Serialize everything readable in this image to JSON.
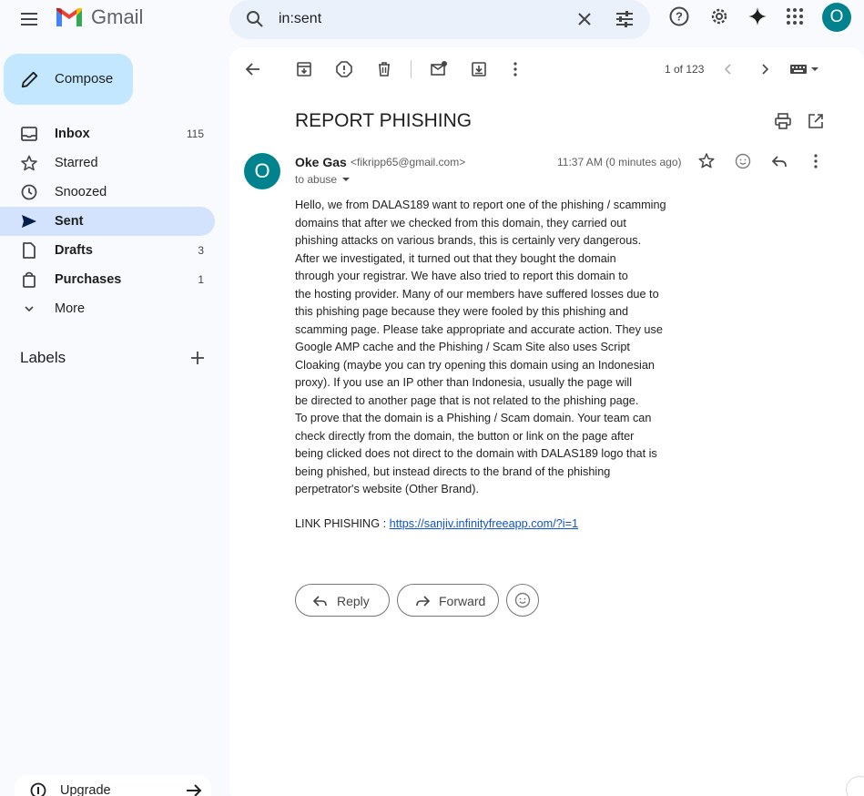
{
  "app": {
    "name": "Gmail"
  },
  "search": {
    "value": "in:sent"
  },
  "account": {
    "initial": "O"
  },
  "sidebar": {
    "compose_label": "Compose",
    "items": [
      {
        "label": "Inbox",
        "count": "115",
        "icon": "inbox-icon"
      },
      {
        "label": "Starred",
        "count": "",
        "icon": "star-icon"
      },
      {
        "label": "Snoozed",
        "count": "",
        "icon": "clock-icon"
      },
      {
        "label": "Sent",
        "count": "",
        "icon": "send-icon"
      },
      {
        "label": "Drafts",
        "count": "3",
        "icon": "draft-icon"
      },
      {
        "label": "Purchases",
        "count": "1",
        "icon": "shopping-bag-icon"
      },
      {
        "label": "More",
        "count": "",
        "icon": "chevron-down-icon"
      }
    ],
    "labels_heading": "Labels",
    "upgrade_label": "Upgrade"
  },
  "toolbar": {
    "pager": "1 of 123"
  },
  "email": {
    "subject": "REPORT PHISHING",
    "sender_initial": "O",
    "sender_name": "Oke Gas",
    "sender_email": "<fikripp65@gmail.com>",
    "to": "to abuse",
    "time": "11:37 AM (0 minutes ago)",
    "body": "Hello, we from DALAS189  want to report one of the phishing / scamming\ndomains that after we checked from this domain, they carried out\nphishing attacks on various brands, this is certainly very dangerous.\nAfter we investigated, it turned out that they bought the domain\nthrough your registrar. We have also tried to report this domain to\nthe hosting provider. Many of our members have suffered losses due to\nthis phishing page because they were fooled by this phishing and\nscamming page. Please take appropriate and accurate action. They use\nGoogle AMP cache and the Phishing / Scam Site also uses Script\nCloaking (maybe you can try opening this domain using an Indonesian\nproxy). If you use an IP other than Indonesia, usually the page will\nbe directed to another page that is not related to the phishing page.\nTo prove that the domain is a Phishing / Scam domain. Your team can\ncheck directly from the domain, the button or link on the page after\nbeing clicked does not direct to the domain with DALAS189 logo that is\nbeing phished, but instead directs to the brand of the phishing\nperpetrator's website (Other Brand).",
    "link_label": "LINK PHISHING : ",
    "link_url": "https://sanjiv.infinityfreeapp.com/?i=1"
  },
  "actions": {
    "reply_label": "Reply",
    "forward_label": "Forward"
  },
  "colors": {
    "accent": "#c2e7ff",
    "active_nav": "#d3e3fd",
    "avatar": "#00838f",
    "link": "#1155cc"
  }
}
